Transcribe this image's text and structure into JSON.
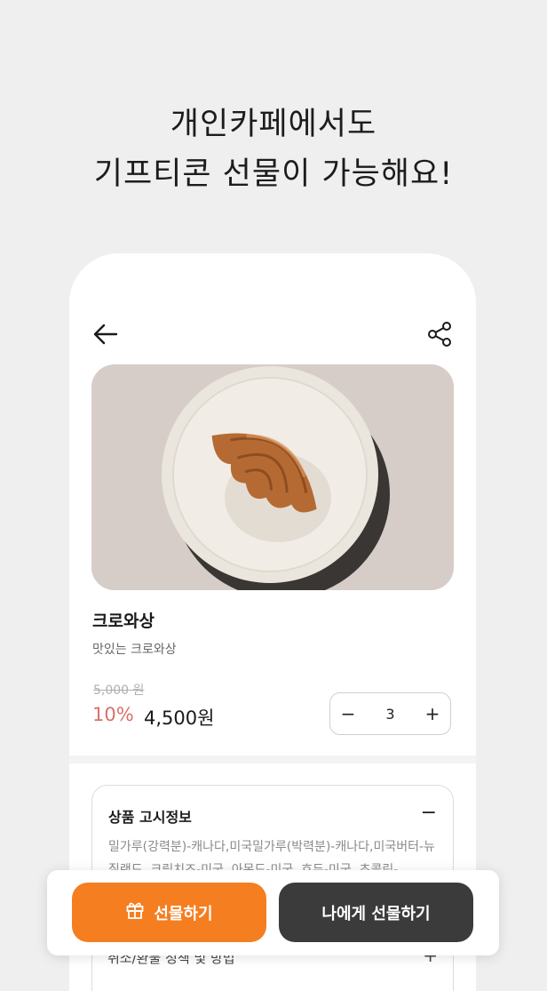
{
  "headline": {
    "line1": "개인카페에서도",
    "line2": "기프티콘 선물이 가능해요!"
  },
  "header": {
    "back_icon": "arrow-left-icon",
    "share_icon": "share-icon"
  },
  "product": {
    "image_icon": "croissant-on-plate-image",
    "name": "크로와상",
    "description": "맛있는 크로와상",
    "original_price": "5,000 원",
    "discount": "10%",
    "price": "4,500원"
  },
  "stepper": {
    "minus": "−",
    "quantity": "3",
    "plus": "+"
  },
  "info": {
    "title": "상품 고시정보",
    "toggle": "−",
    "body": "밀가루(강력분)-캐나다,미국밀가루(박력분)-캐나다,미국버터-뉴질랜드, 크림치즈-미국, 아몬드-미국, 호두-미국, 초콜릿-"
  },
  "refund": {
    "label": "취소/환불 정책 및 방법",
    "toggle": "+"
  },
  "actions": {
    "gift_label": "선물하기",
    "gift_icon": "gift-icon",
    "self_label": "나에게 선물하기"
  },
  "colors": {
    "accent": "#f47e20",
    "dark_button": "#3b3b3b",
    "discount": "#d9716b"
  }
}
